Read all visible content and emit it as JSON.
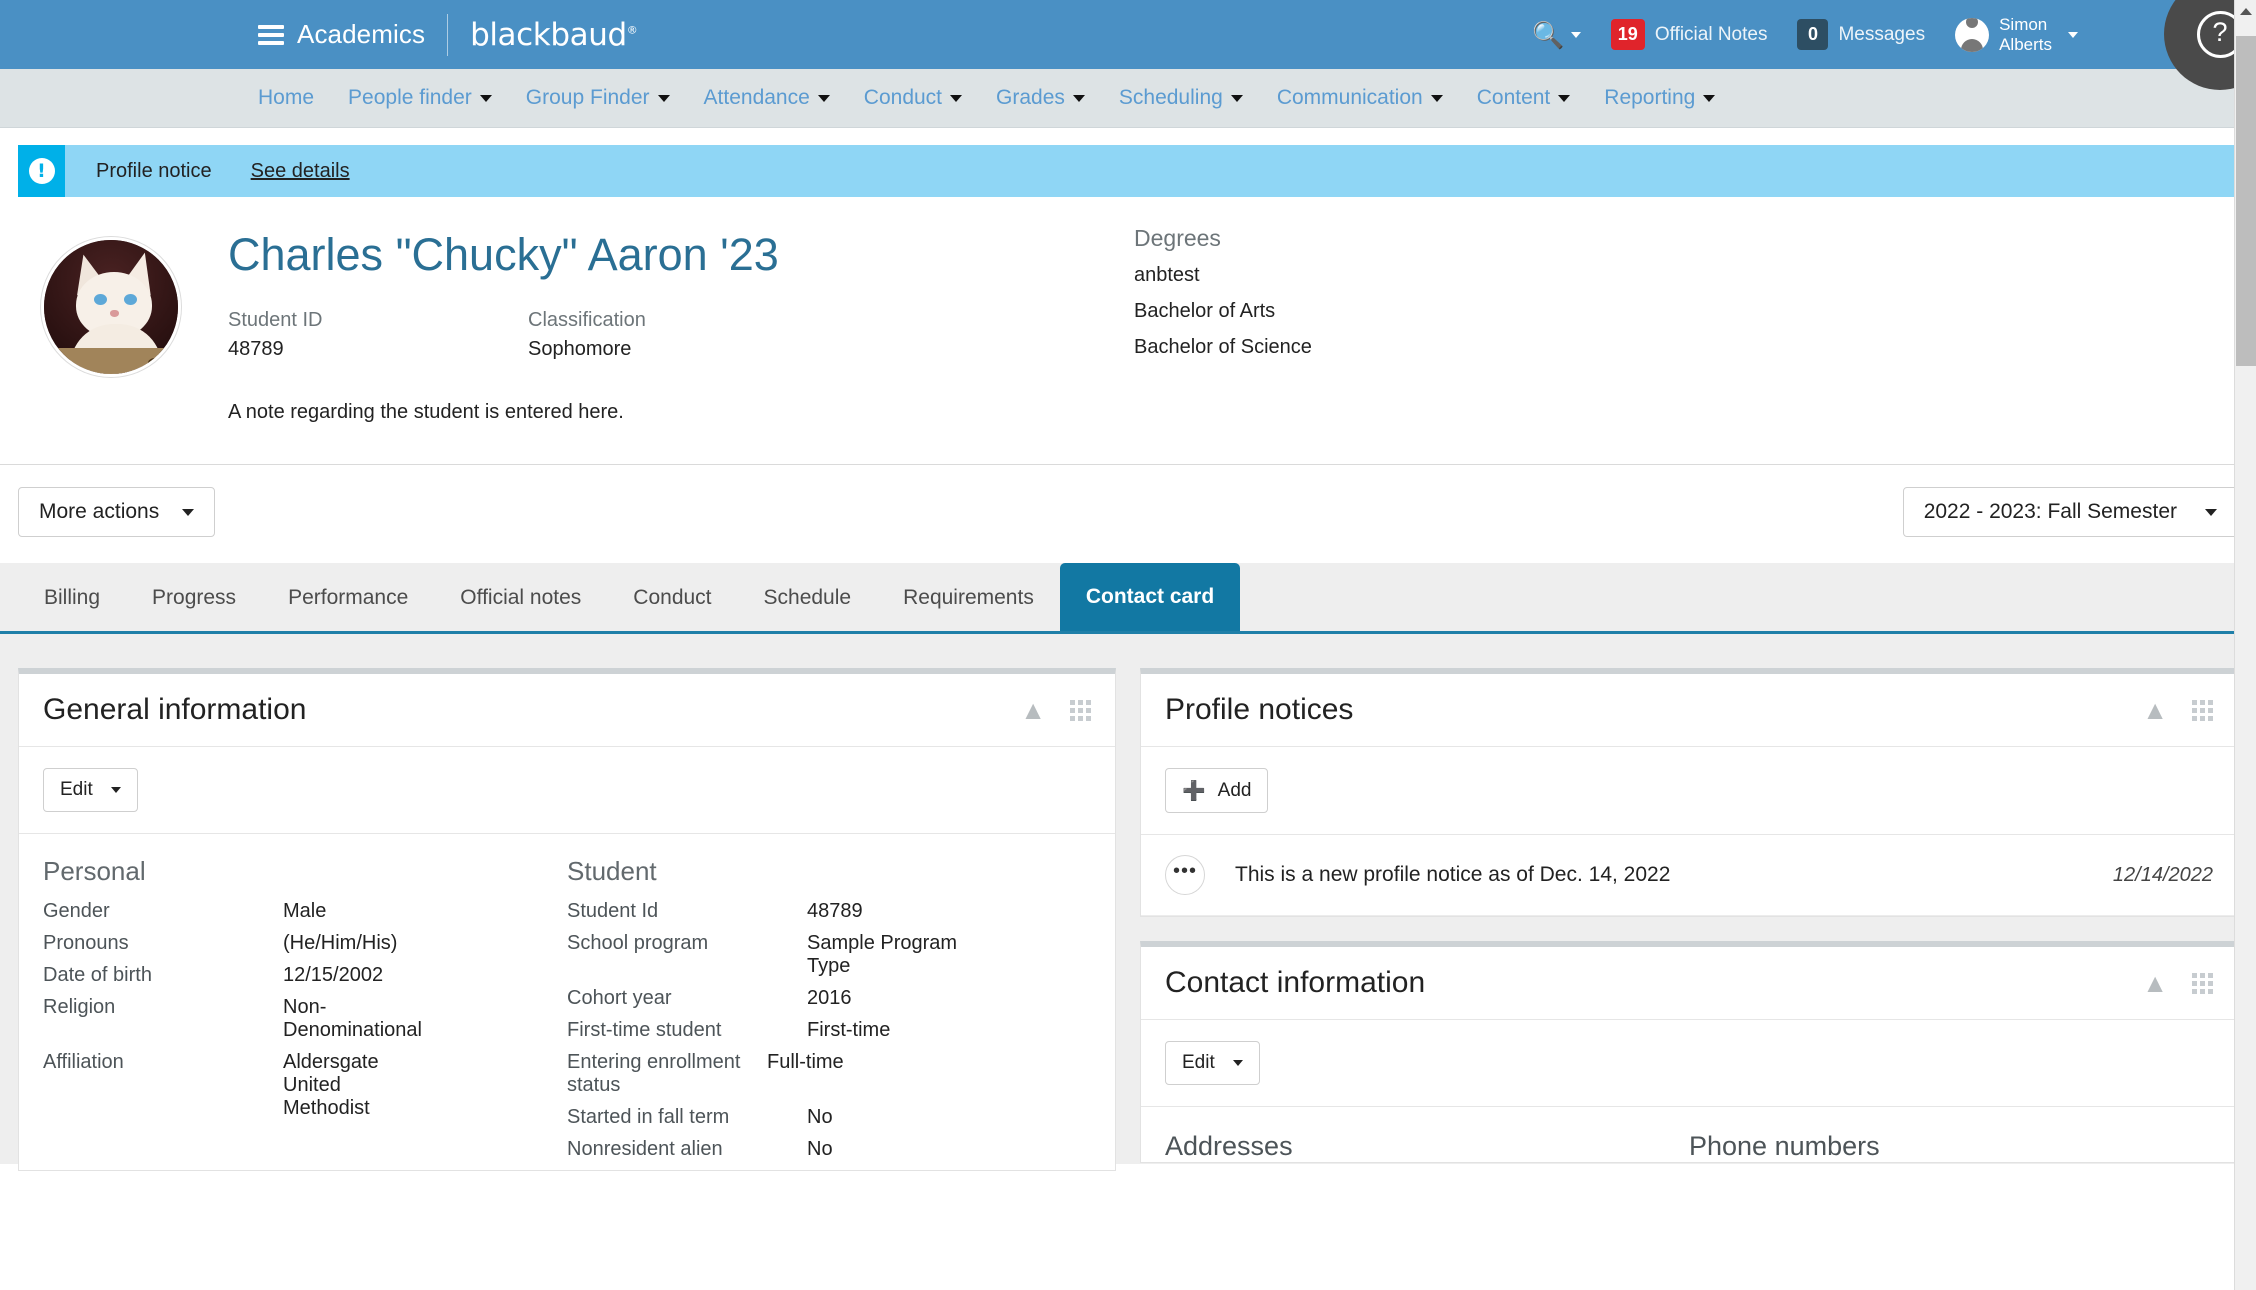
{
  "topbar": {
    "menu_icon": "hamburger-icon",
    "app_name": "Academics",
    "brand": "blackbaud",
    "brand_mark": "®",
    "search_icon": "search-icon",
    "official_notes": {
      "count": "19",
      "label": "Official Notes"
    },
    "messages": {
      "count": "0",
      "label": "Messages"
    },
    "user": {
      "first_name": "Simon",
      "last_name": "Alberts",
      "avatar_icon": "user-avatar-icon"
    },
    "help_icon": "question-mark-icon",
    "bg_color": "#4a90c4"
  },
  "nav": {
    "items": [
      {
        "label": "Home",
        "has_caret": false
      },
      {
        "label": "People finder",
        "has_caret": true
      },
      {
        "label": "Group Finder",
        "has_caret": true
      },
      {
        "label": "Attendance",
        "has_caret": true
      },
      {
        "label": "Conduct",
        "has_caret": true
      },
      {
        "label": "Grades",
        "has_caret": true
      },
      {
        "label": "Scheduling",
        "has_caret": true
      },
      {
        "label": "Communication",
        "has_caret": true
      },
      {
        "label": "Content",
        "has_caret": true
      },
      {
        "label": "Reporting",
        "has_caret": true
      }
    ],
    "link_color": "#5b9bd1"
  },
  "notice_banner": {
    "icon": "exclamation-icon",
    "icon_glyph": "!",
    "title": "Profile notice",
    "link": "See details",
    "bg_color": "#8fd6f5",
    "icon_bg_color": "#00b0e8"
  },
  "student": {
    "avatar_icon": "student-photo-cat",
    "name": "Charles \"Chucky\" Aaron '23",
    "name_color": "#2a6f94",
    "fields": [
      {
        "label": "Student ID",
        "value": "48789"
      },
      {
        "label": "Classification",
        "value": "Sophomore"
      }
    ],
    "degrees_label": "Degrees",
    "degrees": [
      "anbtest",
      "Bachelor of Arts",
      "Bachelor of Science"
    ],
    "note": "A note regarding the student is entered here."
  },
  "actions": {
    "more_actions": "More actions",
    "term": "2022 - 2023: Fall Semester",
    "caret_icon": "chevron-down-icon"
  },
  "tabs": {
    "items": [
      {
        "label": "Billing",
        "active": false
      },
      {
        "label": "Progress",
        "active": false
      },
      {
        "label": "Performance",
        "active": false
      },
      {
        "label": "Official notes",
        "active": false
      },
      {
        "label": "Conduct",
        "active": false
      },
      {
        "label": "Schedule",
        "active": false
      },
      {
        "label": "Requirements",
        "active": false
      },
      {
        "label": "Contact card",
        "active": true
      }
    ],
    "active_bg": "#1278a3"
  },
  "general_information": {
    "title": "General information",
    "collapse_icon": "chevron-up-icon",
    "grid_icon": "grid-icon",
    "edit_label": "Edit",
    "personal": {
      "heading": "Personal",
      "rows": [
        {
          "key": "Gender",
          "value": "Male"
        },
        {
          "key": "Pronouns",
          "value": "(He/Him/His)"
        },
        {
          "key": "Date of birth",
          "value": "12/15/2002"
        },
        {
          "key": "Religion",
          "value": "Non-Denominational"
        },
        {
          "key": "Affiliation",
          "value": "Aldersgate United Methodist"
        }
      ]
    },
    "student_section": {
      "heading": "Student",
      "rows": [
        {
          "key": "Student Id",
          "value": "48789"
        },
        {
          "key": "School program",
          "value": "Sample Program Type"
        },
        {
          "key": "Cohort year",
          "value": "2016"
        },
        {
          "key": "First-time student",
          "value": "First-time"
        },
        {
          "key": "Entering enrollment status",
          "value": "Full-time"
        },
        {
          "key": "Started in fall term",
          "value": "No"
        },
        {
          "key": "Nonresident alien",
          "value": "No"
        }
      ]
    }
  },
  "profile_notices": {
    "title": "Profile notices",
    "collapse_icon": "chevron-up-icon",
    "grid_icon": "grid-icon",
    "add_label": "Add",
    "add_icon": "plus-circle-icon",
    "rows": [
      {
        "menu_icon": "ellipsis-icon",
        "menu_glyph": "•••",
        "text": "This is a new profile notice as of Dec. 14, 2022",
        "date": "12/14/2022"
      }
    ]
  },
  "contact_information": {
    "title": "Contact information",
    "collapse_icon": "chevron-up-icon",
    "grid_icon": "grid-icon",
    "edit_label": "Edit",
    "columns": [
      {
        "heading": "Addresses"
      },
      {
        "heading": "Phone numbers"
      }
    ]
  },
  "scrollbar": {
    "up_arrow_icon": "triangle-up-icon"
  }
}
